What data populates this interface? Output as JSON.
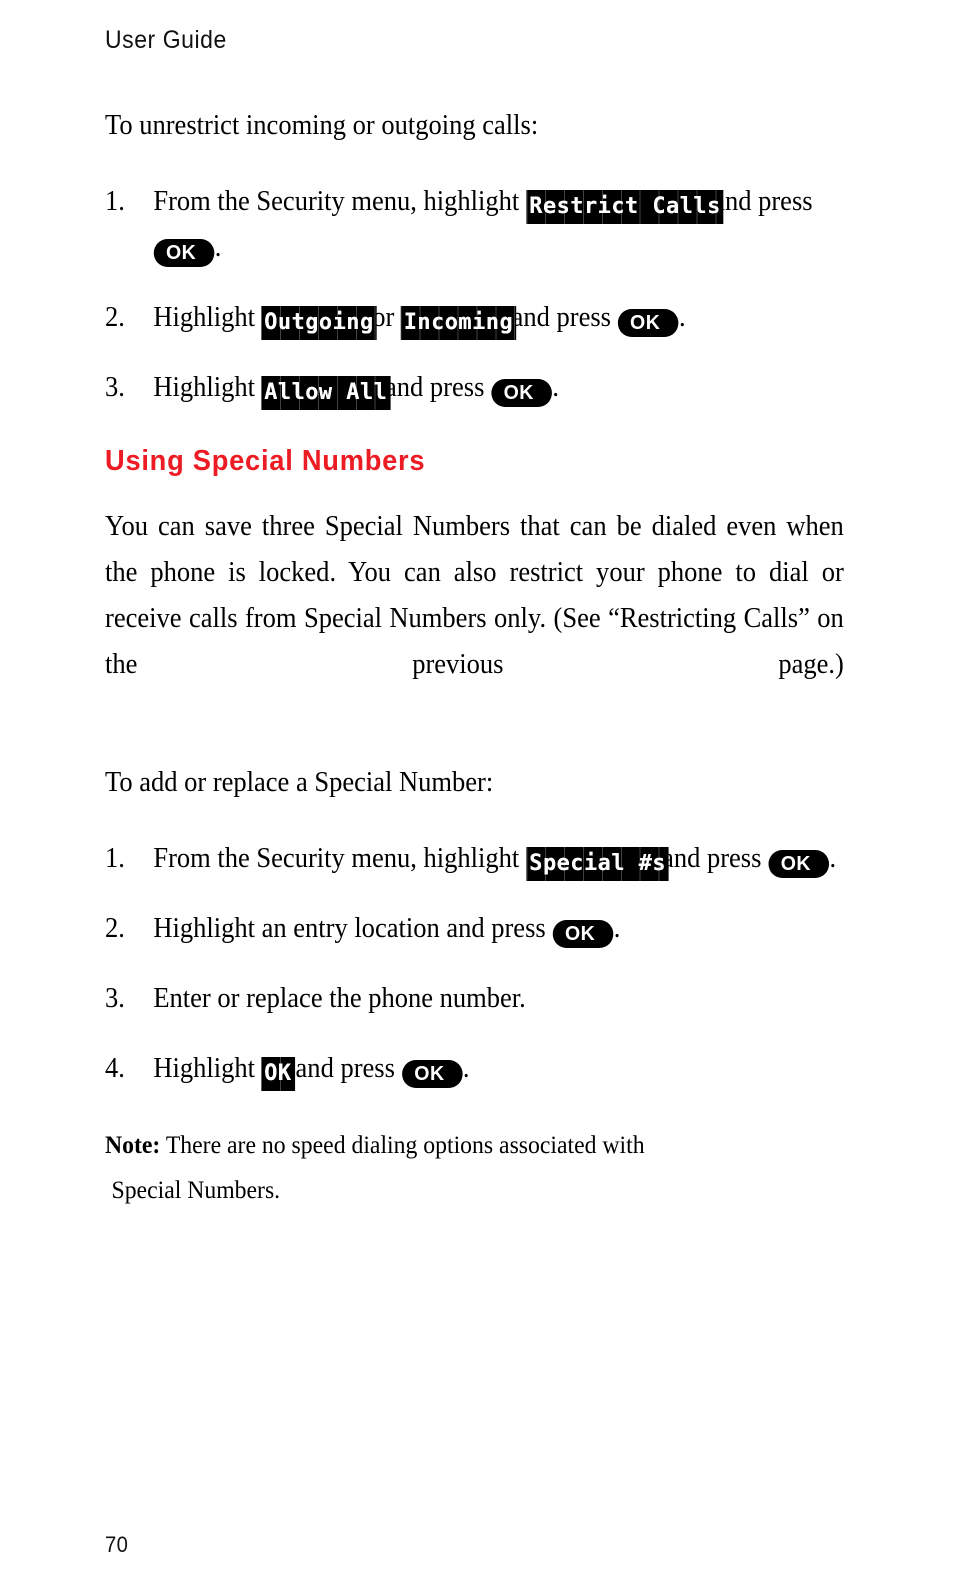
{
  "header": {
    "running_title": "User Guide"
  },
  "colors": {
    "heading_red": "#ED1C24",
    "lcd_background": "#000000",
    "lcd_text": "#FFFFFF",
    "key_background": "#000000",
    "key_text": "#FFFFFF",
    "body_text": "#000000",
    "page_background": "#FFFFFF"
  },
  "intro": {
    "lead": "To unrestrict incoming or outgoing calls:"
  },
  "unrestrict_steps": [
    {
      "number": "1.",
      "text_before": "From the Security menu, highlight",
      "lcd": "Restrict Calls",
      "text_mid": "and press",
      "key": "OK",
      "text_after": "."
    },
    {
      "number": "2.",
      "text_before": "Highlight",
      "lcd": "Outgoing",
      "text_mid": "or",
      "lcd2": "Incoming",
      "text_mid2": "and press",
      "key": "OK",
      "text_after": "."
    },
    {
      "number": "3.",
      "text_before": "Highlight",
      "lcd": "Allow All",
      "text_mid": "and press",
      "key": "OK",
      "text_after": "."
    }
  ],
  "special_numbers": {
    "heading": "Using Special Numbers",
    "body": "You can save three Special Numbers that can be dialed even when the phone is locked. You can also restrict your phone to dial or receive calls from Special Numbers only. (See “Restricting Calls” on the previous page.)",
    "lead": "To add or replace a Special Number:"
  },
  "special_steps": [
    {
      "number": "1.",
      "text_before": "From the Security menu, highlight",
      "lcd": "Special #s",
      "text_mid": "and press",
      "key": "OK",
      "text_after": "."
    },
    {
      "number": "2.",
      "text_before": "Highlight an entry location and press",
      "key": "OK",
      "text_after": "."
    },
    {
      "number": "3.",
      "text_before": "Enter or replace the phone number."
    },
    {
      "number": "4.",
      "text_before": "Highlight",
      "lcd": "OK",
      "text_mid": "and press",
      "key": "OK",
      "text_after": "."
    }
  ],
  "note": {
    "label": "Note:",
    "line1": "There are no speed dialing options associated with",
    "line2": "Special Numbers."
  },
  "footer": {
    "page_number": "70"
  }
}
